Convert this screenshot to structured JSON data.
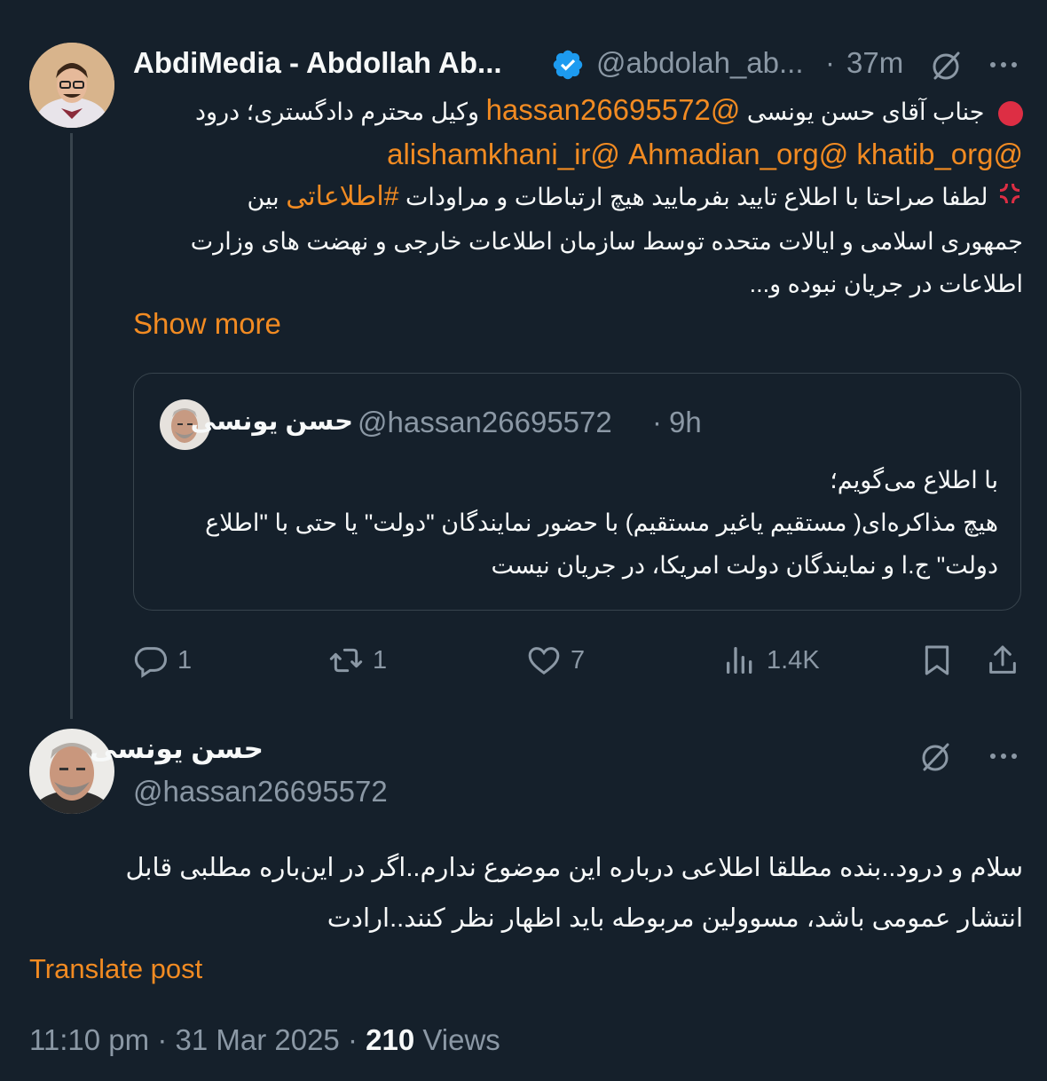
{
  "colors": {
    "background": "#15202b",
    "accent": "#f28b22",
    "muted": "#8b98a5",
    "verified": "#1d9bf0",
    "red_dot": "#dd2e44"
  },
  "tweet1": {
    "author_name": "AbdiMedia - Abdollah Ab...",
    "handle": "@abdolah_ab...",
    "sep": "·",
    "time": "37m",
    "verified_icon": "verified-badge-icon",
    "grok_icon": "grok-icon",
    "more_icon": "more-icon",
    "line1_pre": "جناب آقای حسن یونسی",
    "line1_mention": "@hassan26695572",
    "line1_post": "وکیل محترم دادگستری؛ درود",
    "mentions": [
      "@khatib_org",
      "@Ahmadian_org",
      "@alishamkhani_ir"
    ],
    "line3_pre": "لطفا صراحتا با اطلاع تایید بفرمایید هیچ ارتباطات و مراودات",
    "line3_hashtag": "#اطلاعاتی",
    "line3_post": "بین",
    "line4": "جمهوری اسلامی و ایالات متحده توسط سازمان اطلاعات خارجی و نهضت های وزارت",
    "line5": "اطلاعات در جریان نبوده و...",
    "show_more": "Show more",
    "quote": {
      "author_name": "حسن یونسی",
      "handle": "@hassan26695572",
      "sep": "·",
      "time": "9h",
      "line1": "با اطلاع می‌گویم؛",
      "line2": "هیچ مذاکره‌ای( مستقیم یاغیر مستقیم) با حضور نمایندگان \"دولت\" یا حتی با \"اطلاع",
      "line3": "دولت\" ج.ا و نمایندگان دولت امریکا، در جریان نیست"
    },
    "actions": {
      "replies": "1",
      "reposts": "1",
      "likes": "7",
      "views": "1.4K"
    }
  },
  "tweet2": {
    "author_name": "حسن یونسی",
    "handle": "@hassan26695572",
    "line1": "سلام و درود..بنده مطلقا اطلاعی درباره این موضوع ندارم..اگر در این‌باره مطلبی قابل",
    "line2": "انتشار عمومی باشد، مسوولین مربوطه باید اظهار نظر کنند..ارادت",
    "translate": "Translate post",
    "time": "11:10 pm",
    "sep1": "·",
    "date": "31 Mar 2025",
    "sep2": "·",
    "views_count": "210",
    "views_label": "Views"
  }
}
